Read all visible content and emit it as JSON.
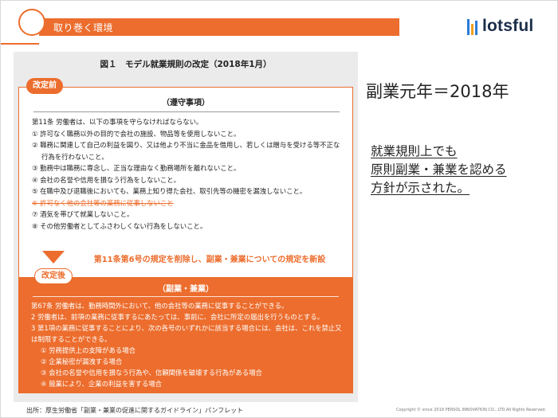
{
  "header": {
    "section_title": "取り巻く環境",
    "accent_color": "#ec6d2d"
  },
  "logo": {
    "text": "lotsful",
    "icon": "lotsful-bars-icon"
  },
  "figure": {
    "title": "図１　モデル就業規則の改定（2018年1月）",
    "before": {
      "tag": "改定前",
      "heading": "（遵守事項）",
      "intro": "第11条 労働者は、以下の事項を守らなければならない。",
      "items": [
        "① 許可なく職務以外の目的で会社の施設、物品等を使用しないこと。",
        "② 職務に関連して自己の利益を図り、又は他より不当に金品を借用し、若しくは贈与を受ける等不正な行為を行わないこと。",
        "③ 勤務中は職務に専念し、正当な理由なく勤務場所を離れないこと。",
        "④ 会社の名誉や信用を損なう行為をしないこと。",
        "⑤ 在職中及び退職後においても、業務上知り得た会社、取引先等の機密を漏洩しないこと。",
        "⑥ 許可なく他の会社等の業務に従事しないこと",
        "⑦ 酒気を帯びて就業しないこと。",
        "⑧ その他労働者としてふさわしくない行為をしないこと。"
      ],
      "struck_item_index": 5
    },
    "change_note": "第11条第6号の規定を削除し、副業・兼業についての規定を新設",
    "after": {
      "tag": "改定後",
      "heading": "（副業・兼業）",
      "paragraphs": [
        "第67条 労働者は、勤務時間外において、他の会社等の業務に従事することができる。",
        "2 労働者は、前項の業務に従事するにあたっては、事前に、会社に所定の届出を行うものとする。",
        "3 第1項の業務に従事することにより、次の各号のいずれかに該当する場合には、会社は、これを禁止又は制限することができる。"
      ],
      "sub_items": [
        "① 労務提供上の支障がある場合",
        "② 企業秘密が漏洩する場合",
        "③ 会社の名誉や信用を損なう行為や、信頼関係を破壊する行為がある場合",
        "④ 競業により、企業の利益を害する場合"
      ]
    },
    "source": "出所：厚生労働省「副業・兼業の促進に関するガイドライン」パンフレット"
  },
  "main": {
    "headline": "副業元年＝2018年",
    "note_lines": [
      "就業規則上でも",
      "原則副業・兼業を認める",
      "方針が示された。"
    ]
  },
  "footer": {
    "copyright": "Copyright © since 2019 PERSOL INNOVATION CO., LTD.All Rights Reserved."
  }
}
